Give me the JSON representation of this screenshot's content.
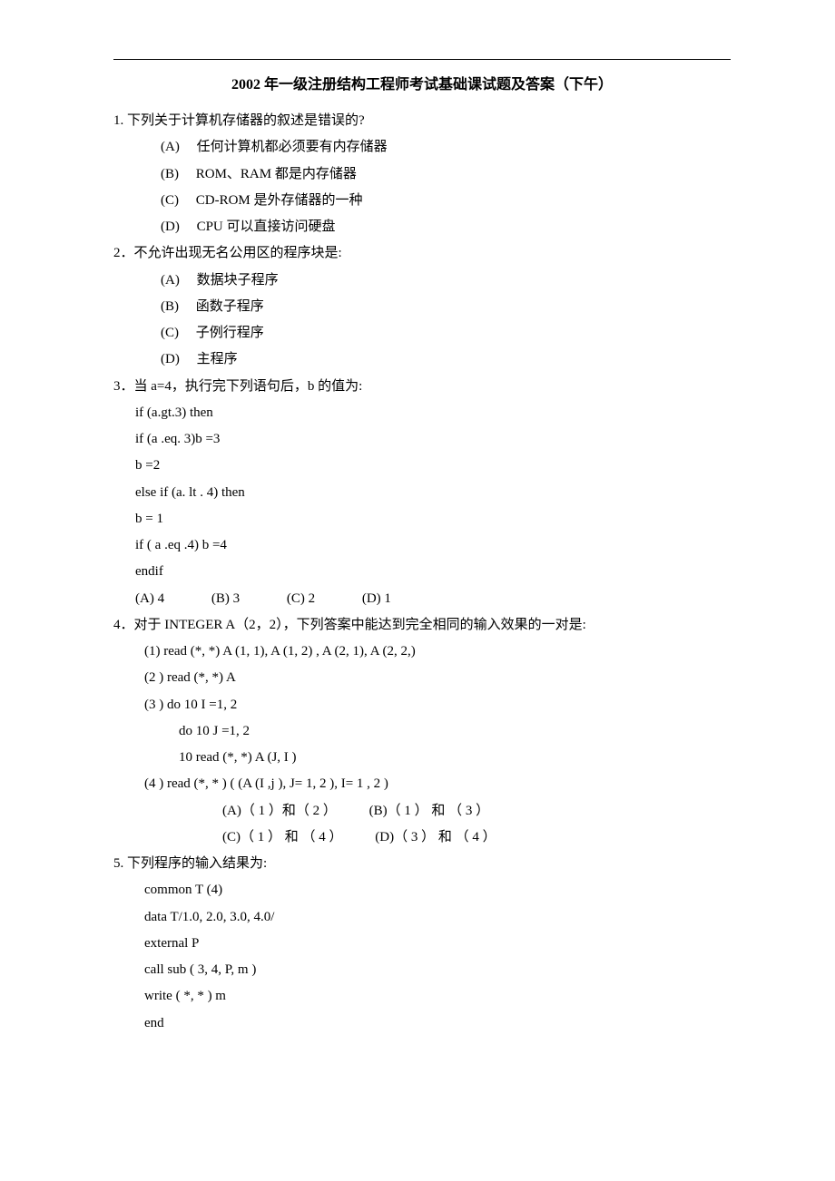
{
  "title": "2002 年一级注册结构工程师考试基础课试题及答案（下午）",
  "q1": {
    "stem": "1. 下列关于计算机存储器的叙述是错误的?",
    "a": "(A)　 任何计算机都必须要有内存储器",
    "b": "(B)　 ROM、RAM 都是内存储器",
    "c": "(C)　 CD-ROM 是外存储器的一种",
    "d": "(D)　 CPU 可以直接访问硬盘"
  },
  "q2": {
    "stem": "2．不允许出现无名公用区的程序块是:",
    "a": "(A)　 数据块子程序",
    "b": "(B)　 函数子程序",
    "c": "(C)　 子例行程序",
    "d": "(D)　 主程序"
  },
  "q3": {
    "stem": "3．当 a=4，执行完下列语句后，b 的值为:",
    "c1": "if (a.gt.3)  then",
    "c2": "if (a .eq. 3)b =3",
    "c3": "b =2",
    "c4": "else if (a. lt . 4) then",
    "c5": "b = 1",
    "c6": "if ( a .eq .4) b =4",
    "c7": "endif",
    "oA": "(A) 4",
    "oB": "(B) 3",
    "oC": "(C) 2",
    "oD": "(D) 1"
  },
  "q4": {
    "stem": "4．对于 INTEGER A（2，2），下列答案中能达到完全相同的输入效果的一对是:",
    "c1": "(1)  read (*, *)   A (1, 1),  A (1, 2) , A (2, 1), A (2, 2,)",
    "c2": "(2 )  read (*, *)  A",
    "c3": "(3 )  do 10 I =1, 2",
    "c3a": "do 10 J =1, 2",
    "c3b": "10  read (*, *) A (J, I )",
    "c4": "(4 )  read  (*, * ) ( (A (I ,j ), J= 1, 2 ), I= 1 , 2 )",
    "oA": "(A)（ 1 ）和（ 2 ）",
    "oB": "(B)（ 1 ） 和 （ 3 ）",
    "oC": "(C)（ 1 ） 和 （ 4 ）",
    "oD": "(D)（ 3 ） 和 （ 4 ）"
  },
  "q5": {
    "stem": "5.  下列程序的输入结果为:",
    "c1": "common T (4)",
    "c2": "data  T/1.0,  2.0,  3.0,   4.0/",
    "c3": "external P",
    "c4": "call sub ( 3, 4, P, m )",
    "c5": "write ( *, * ) m",
    "c6": "end"
  }
}
